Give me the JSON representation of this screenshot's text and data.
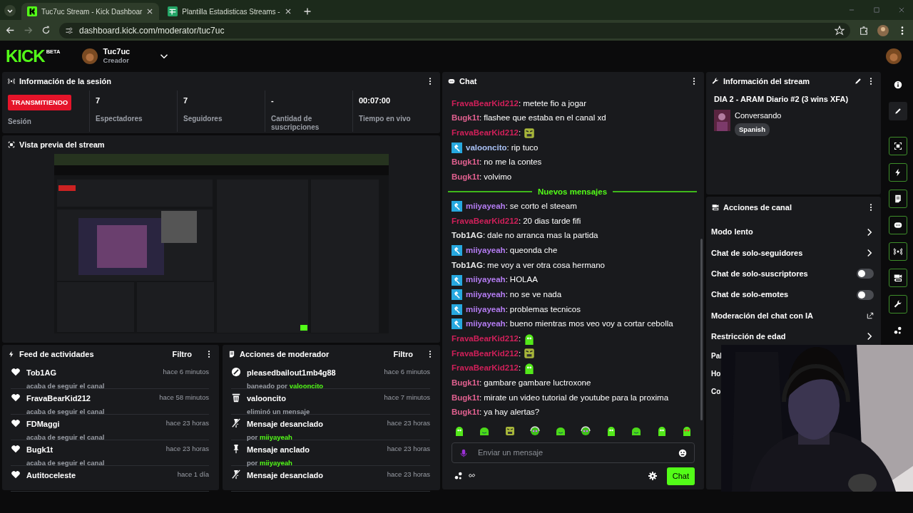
{
  "browser": {
    "tabs": [
      {
        "title": "Tuc7uc Stream - Kick Dashboar",
        "kind": "kick",
        "selected": true
      },
      {
        "title": "Plantilla Estadisticas Streams -",
        "kind": "sheet",
        "selected": false
      }
    ],
    "url": "dashboard.kick.com/moderator/tuc7uc"
  },
  "header": {
    "logo": "KICK",
    "badge": "BETA",
    "user": "Tuc7uc",
    "role": "Creador"
  },
  "session": {
    "title": "Información de la sesión",
    "status": "TRANSMITIENDO",
    "status_label": "Sesión",
    "stats": [
      {
        "value": "7",
        "label": "Espectadores"
      },
      {
        "value": "7",
        "label": "Seguidores"
      },
      {
        "value": "-",
        "label": "Cantidad de suscripciones"
      },
      {
        "value": "00:07:00",
        "label": "Tiempo en vivo"
      }
    ]
  },
  "preview": {
    "title": "Vista previa del stream",
    "kind": "picture"
  },
  "activity_feed": {
    "title": "Feed de actividades",
    "filter": "Filtro",
    "items": [
      {
        "name": "Tob1AG",
        "action": "acaba de seguir el canal",
        "time": "hace 6 minutos"
      },
      {
        "name": "FravaBearKid212",
        "action": "acaba de seguir el canal",
        "time": "hace 58 minutos"
      },
      {
        "name": "FDMaggi",
        "action": "acaba de seguir el canal",
        "time": "hace 23 horas"
      },
      {
        "name": "Bugk1t",
        "action": "acaba de seguir el canal",
        "time": "hace 23 horas"
      },
      {
        "name": "Autitoceleste",
        "time": "hace 1 día"
      }
    ]
  },
  "mod_actions": {
    "title": "Acciones de moderador",
    "filter": "Filtro",
    "items": [
      {
        "kind": "ban",
        "title": "pleasedbailout1mb4g88",
        "detail": "baneado por",
        "by": "valooncito",
        "time": "hace 6 minutos"
      },
      {
        "kind": "delete",
        "title": "valooncito",
        "detail": "eliminó un mensaje",
        "time": "hace 7 minutos"
      },
      {
        "kind": "unpin",
        "title": "Mensaje desanclado",
        "detail": "por",
        "by": "miiyayeah",
        "time": "hace 23 horas"
      },
      {
        "kind": "pin",
        "title": "Mensaje anclado",
        "detail": "por",
        "by": "miiyayeah",
        "time": "hace 23 horas"
      },
      {
        "kind": "unpin",
        "title": "Mensaje desanclado",
        "time": "hace 23 horas"
      }
    ]
  },
  "chat": {
    "title": "Chat",
    "messages": [
      {
        "kind": "text",
        "user": "FravaBearKid212",
        "sep": ":",
        "color": "#d0205a",
        "moderator": false,
        "text": "metete fio a jogar"
      },
      {
        "kind": "text",
        "user": "Bugk1t",
        "sep": ":",
        "color": "#e0608f",
        "moderator": false,
        "text": "flashee que estaba en el canal xd"
      },
      {
        "kind": "emote_angry",
        "user": "FravaBearKid212",
        "sep": ":",
        "color": "#d0205a",
        "moderator": false
      },
      {
        "kind": "text",
        "user": "valooncito",
        "sep": ":",
        "color": "#a9c1f5",
        "moderator": true,
        "text": "rip tuco"
      },
      {
        "kind": "text",
        "user": "Bugk1t",
        "sep": ":",
        "color": "#e0608f",
        "moderator": false,
        "text": "no me la contes"
      },
      {
        "kind": "text",
        "user": "Bugk1t",
        "sep": ":",
        "color": "#e0608f",
        "moderator": false,
        "text": "volvimo"
      },
      {
        "kind": "divider",
        "text": "Nuevos mensajes"
      },
      {
        "kind": "text",
        "user": "miiyayeah",
        "sep": ":",
        "color": "#b47cf2",
        "moderator": true,
        "text": "se corto el steeam"
      },
      {
        "kind": "text",
        "user": "FravaBearKid212",
        "sep": ":",
        "color": "#d0205a",
        "moderator": false,
        "text": "20 dias tarde fifi"
      },
      {
        "kind": "text",
        "user": "Tob1AG",
        "sep": ":",
        "color": "#e8e8e8",
        "moderator": false,
        "text": "dale no arranca mas la partida"
      },
      {
        "kind": "text",
        "user": "miiyayeah",
        "sep": ":",
        "color": "#b47cf2",
        "moderator": true,
        "text": "queonda che"
      },
      {
        "kind": "text",
        "user": "Tob1AG",
        "sep": ":",
        "color": "#e8e8e8",
        "moderator": false,
        "text": "me voy a ver otra cosa hermano"
      },
      {
        "kind": "text",
        "user": "miiyayeah",
        "sep": ":",
        "color": "#b47cf2",
        "moderator": true,
        "text": "HOLAA"
      },
      {
        "kind": "text",
        "user": "miiyayeah",
        "sep": ":",
        "color": "#b47cf2",
        "moderator": true,
        "text": "no se ve nada"
      },
      {
        "kind": "text",
        "user": "miiyayeah",
        "sep": ":",
        "color": "#b47cf2",
        "moderator": true,
        "text": "problemas tecnicos"
      },
      {
        "kind": "text",
        "user": "miiyayeah",
        "sep": ":",
        "color": "#b47cf2",
        "moderator": true,
        "text": "bueno mientras mos veo voy a cortar cebolla"
      },
      {
        "kind": "emote_blob",
        "user": "FravaBearKid212",
        "sep": ":",
        "color": "#d0205a",
        "moderator": false
      },
      {
        "kind": "emote_angry",
        "user": "FravaBearKid212",
        "sep": ":",
        "color": "#d0205a",
        "moderator": false
      },
      {
        "kind": "emote_blob",
        "user": "FravaBearKid212",
        "sep": ":",
        "color": "#d0205a",
        "moderator": false
      },
      {
        "kind": "text",
        "user": "Bugk1t",
        "sep": ":",
        "color": "#e0608f",
        "moderator": false,
        "text": "gambare gambare luctroxone"
      },
      {
        "kind": "text",
        "user": "Bugk1t",
        "sep": ":",
        "color": "#e0608f",
        "moderator": false,
        "text": "mirate un video tutorial de youtube para la proxima"
      },
      {
        "kind": "text",
        "user": "Bugk1t",
        "sep": ":",
        "color": "#e0608f",
        "moderator": false,
        "text": "ya hay alertas?"
      }
    ],
    "emotes": [
      {
        "kind": "blob"
      },
      {
        "kind": "smile"
      },
      {
        "kind": "angry"
      },
      {
        "kind": "headset"
      },
      {
        "kind": "smile"
      },
      {
        "kind": "headset"
      },
      {
        "kind": "blob"
      },
      {
        "kind": "smile"
      },
      {
        "kind": "blob"
      },
      {
        "kind": "hearts"
      }
    ],
    "placeholder": "Enviar un mensaje",
    "send": "Chat"
  },
  "stream_info": {
    "title": "Información del stream",
    "stream_title": "DIA 2 - ARAM Diario #2 (3 wins XFA)",
    "category": "Conversando",
    "language": "Spanish"
  },
  "channel_actions": {
    "title": "Acciones de canal",
    "items": [
      {
        "label": "Modo lento",
        "kind": "chevron"
      },
      {
        "label": "Chat de solo-seguidores",
        "kind": "chevron"
      },
      {
        "label": "Chat de solo-suscriptores",
        "kind": "toggle",
        "on": false
      },
      {
        "label": "Chat de solo-emotes",
        "kind": "toggle",
        "on": false
      },
      {
        "label": "Moderación del chat con IA",
        "kind": "external"
      },
      {
        "label": "Restricción de edad",
        "kind": "chevron"
      },
      {
        "label": "Pal",
        "kind": "plain"
      },
      {
        "label": "Ho",
        "kind": "plain"
      },
      {
        "label": "Co",
        "kind": "plain"
      }
    ]
  },
  "rail": [
    {
      "kind": "info",
      "active": false
    },
    {
      "kind": "pencil",
      "active": false
    },
    {
      "kind": "screen",
      "active": true
    },
    {
      "kind": "bolt",
      "active": true
    },
    {
      "kind": "doc",
      "active": true
    },
    {
      "kind": "chat",
      "active": true
    },
    {
      "kind": "broadcast",
      "active": true
    },
    {
      "kind": "camera",
      "active": true
    },
    {
      "kind": "wrench",
      "active": true
    },
    {
      "kind": "dots",
      "active": false
    }
  ]
}
